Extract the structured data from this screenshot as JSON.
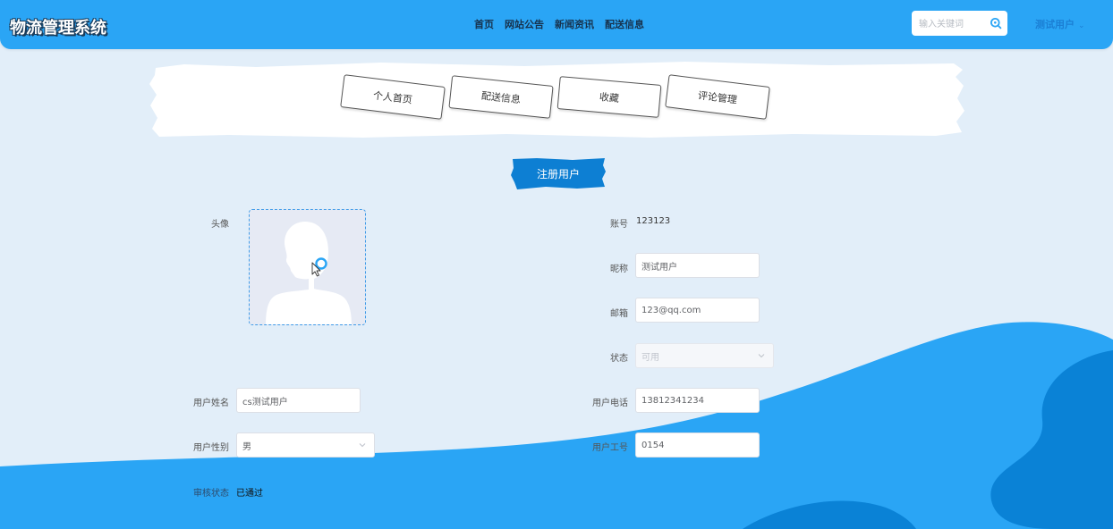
{
  "header": {
    "logo": "物流管理系统",
    "nav": [
      "首页",
      "网站公告",
      "新闻资讯",
      "配送信息"
    ],
    "search_placeholder": "输入关键词",
    "user_name": "测试用户",
    "user_caret": "⌄"
  },
  "tabs": [
    "个人首页",
    "配送信息",
    "收藏",
    "评论管理"
  ],
  "register_button": "注册用户",
  "form": {
    "avatar_label": "头像",
    "account_label": "账号",
    "account_value": "123123",
    "nickname_label": "昵称",
    "nickname_value": "测试用户",
    "email_label": "邮箱",
    "email_value": "123@qq.com",
    "status_label": "状态",
    "status_value": "可用",
    "realname_label": "用户姓名",
    "realname_value": "cs测试用户",
    "phone_label": "用户电话",
    "phone_value": "13812341234",
    "gender_label": "用户性别",
    "gender_value": "男",
    "empno_label": "用户工号",
    "empno_value": "0154",
    "audit_label": "审核状态",
    "audit_value": "已通过"
  },
  "colors": {
    "header_bg": "#2aa5f5",
    "page_bg": "#e2eef9",
    "wave": "#2aa5f5",
    "wave_dark": "#0a82d6",
    "accent": "#1b7fd4"
  }
}
